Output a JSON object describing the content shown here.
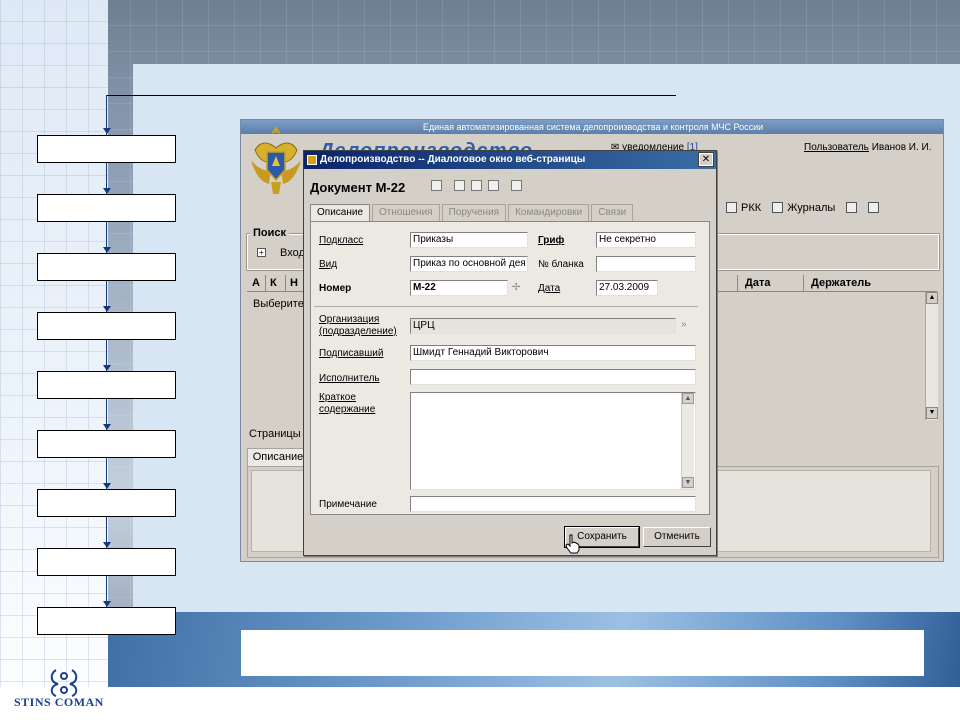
{
  "app": {
    "system_title": "Единая автоматизированная система делопроизводства и контроля МЧС России",
    "brand": "Делопроизводство",
    "notice_label": "уведомление",
    "notice_count": "[1]",
    "user_label": "Пользователь",
    "user_name": "Иванов И. И.",
    "toolbar": {
      "rkk": "РКК",
      "journals": "Журналы"
    },
    "search_label": "Поиск",
    "expander_label": "Вход",
    "grid_columns": [
      "А",
      "К",
      "Н",
      "Дата",
      "Держатель"
    ],
    "grid_hint": "Выберите",
    "pages_label": "Страницы",
    "bottom_tab": "Описание"
  },
  "dialog": {
    "title": "Делопроизводство -- Диалоговое окно веб-страницы",
    "close": "✕",
    "doc_title": "Документ М-22",
    "tabs": [
      {
        "label": "Описание",
        "active": true
      },
      {
        "label": "Отношения",
        "active": false
      },
      {
        "label": "Поручения",
        "active": false
      },
      {
        "label": "Командировки",
        "active": false
      },
      {
        "label": "Связи",
        "active": false
      }
    ],
    "fields": {
      "subclass_label": "Подкласс",
      "subclass_value": "Приказы",
      "grif_label": "Гриф",
      "grif_value": "Не секретно",
      "kind_label": "Вид",
      "kind_value": "Приказ по основной дея",
      "form_no_label": "№ бланка",
      "form_no_value": "",
      "number_label": "Номер",
      "number_value": "М-22",
      "date_label": "Дата",
      "date_value": "27.03.2009",
      "org_label_1": "Организация",
      "org_label_2": "(подразделение)",
      "org_value": "ЦРЦ",
      "signer_label": "Подписавший",
      "signer_value": "Шмидт Геннадий Викторович",
      "executor_label": "Исполнитель",
      "executor_value": "",
      "summary_label_1": "Краткое",
      "summary_label_2": "содержание",
      "summary_value": "",
      "note_label": "Примечание",
      "note_value": ""
    },
    "buttons": {
      "save": "Сохранить",
      "cancel": "Отменить"
    }
  },
  "slide": {
    "logo_text": "STINS COMAN",
    "flow_steps": [
      "",
      "",
      "",
      "",
      "",
      "",
      "",
      "",
      ""
    ]
  }
}
